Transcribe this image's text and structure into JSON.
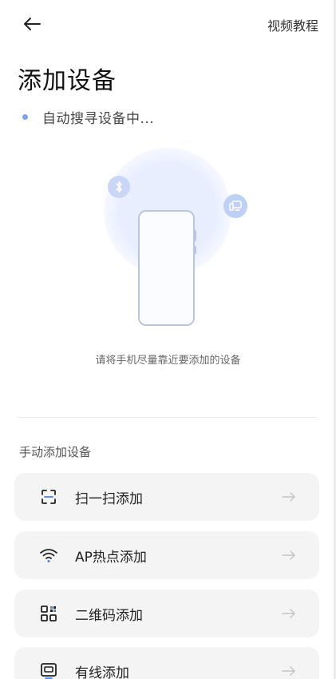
{
  "header": {
    "back_icon": "arrow-left-icon",
    "tutorial_label": "视频教程"
  },
  "page": {
    "title": "添加设备",
    "status_text": "自动搜寻设备中...",
    "hint": "请将手机尽量靠近要添加的设备"
  },
  "manual": {
    "section_label": "手动添加设备",
    "options": [
      {
        "label": "扫一扫添加",
        "icon": "scan-icon"
      },
      {
        "label": "AP热点添加",
        "icon": "wifi-icon"
      },
      {
        "label": "二维码添加",
        "icon": "qr-code-icon"
      },
      {
        "label": "有线添加",
        "icon": "wired-device-icon"
      }
    ]
  },
  "colors": {
    "accent": "#7aa4e6",
    "card_bg": "#f4f4f4",
    "glow": "#e9eeff"
  }
}
